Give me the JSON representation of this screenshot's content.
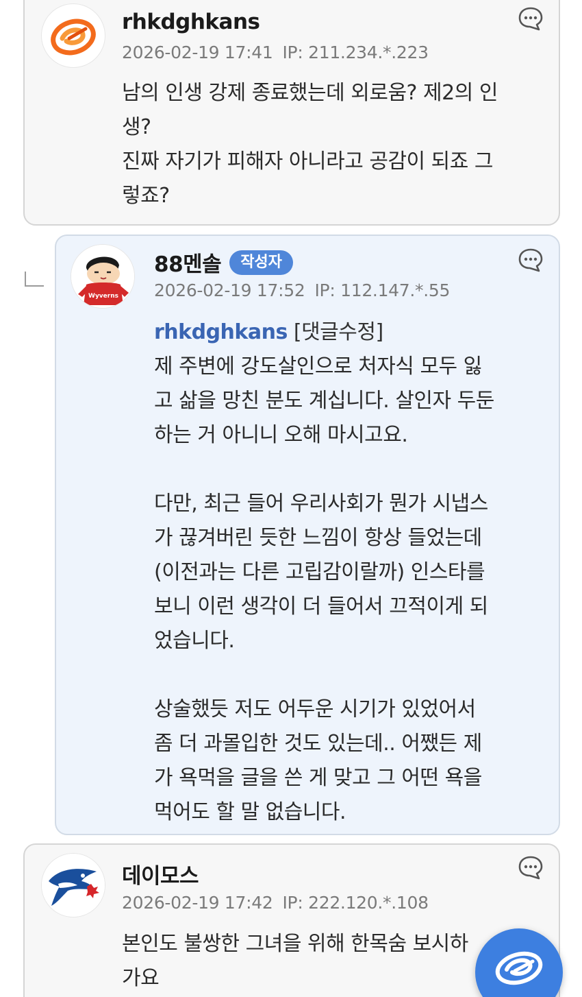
{
  "comments": [
    {
      "author": "rhkdghkans",
      "date": "2026-02-19 17:41",
      "ip": "IP: 211.234.*.223",
      "text_lines": [
        "남의 인생 강제 종료했는데 외로움? 제2의 인",
        "생?",
        "진짜 자기가 피해자 아니라고 공감이 되죠 그",
        "렇죠?"
      ]
    },
    {
      "author": "88멘솔",
      "badge": "작성자",
      "date": "2026-02-19 17:52",
      "ip": "IP: 112.147.*.55",
      "mention": "rhkdghkans",
      "edit_tag": "[댓글수정]",
      "text_lines": [
        "제 주변에 강도살인으로 처자식 모두 잃",
        "고 삶을 망친 분도 계십니다. 살인자 두둔",
        "하는 거 아니니 오해 마시고요.",
        "",
        "다만, 최근 들어 우리사회가 뭔가 시냅스",
        "가 끊겨버린 듯한 느낌이 항상 들었는데",
        "(이전과는 다른 고립감이랄까) 인스타를",
        "보니 이런 생각이 더 들어서 끄적이게 되",
        "었습니다.",
        "",
        "상술했듯 저도 어두운 시기가 있었어서",
        "좀 더 과몰입한 것도 있는데.. 어쨌든 제",
        "가 욕먹을 글을 쓴 게 맞고 그 어떤 욕을",
        "먹어도 할 말 없습니다."
      ]
    },
    {
      "author": "데이모스",
      "date": "2026-02-19 17:42",
      "ip": "IP: 222.120.*.108",
      "text_lines": [
        "본인도 불쌍한 그녀을 위해 한목숨 보시하",
        "가요"
      ]
    }
  ],
  "icons": {
    "reply": "speech-bubble-icon",
    "fab": "app-logo-icon"
  },
  "colors": {
    "mention": "#3a65b3",
    "badge": "#4f86d9",
    "reply_card_bg": "#eef4fc",
    "card_bg": "#f7f7f7",
    "fab": "#3d7fe0"
  }
}
